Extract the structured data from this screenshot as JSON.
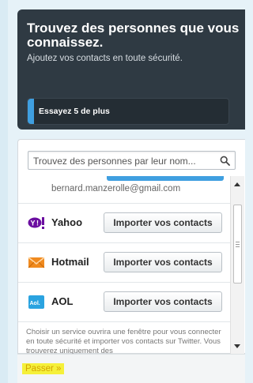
{
  "header": {
    "title": "Trouvez des personnes que vous connaissez.",
    "subtitle": "Ajoutez vos contacts en toute sécurité."
  },
  "progress": {
    "label": "Essayez 5 de plus",
    "fill_fraction": 0.03,
    "color": "#3f9fe0"
  },
  "search": {
    "placeholder": "Trouvez des personnes par leur nom...",
    "icon": "search-icon"
  },
  "contacts": {
    "email": "bernard.manzerolle@gmail.com"
  },
  "providers": [
    {
      "name": "Yahoo",
      "button_label": "Importer vos contacts",
      "icon": "yahoo-logo-icon",
      "color": "#6b0ea0"
    },
    {
      "name": "Hotmail",
      "button_label": "Importer vos contacts",
      "icon": "hotmail-logo-icon",
      "color": "#f08a1f"
    },
    {
      "name": "AOL",
      "button_label": "Importer vos contacts",
      "icon": "aol-logo-icon",
      "color": "#2aa3e0"
    }
  ],
  "info_text": "Choisir un service ouvrira une fenêtre pour vous connecter en toute sécurité et importer vos contacts sur Twitter. Vous trouverez uniquement des",
  "footer": {
    "skip_label": "Passer »"
  }
}
